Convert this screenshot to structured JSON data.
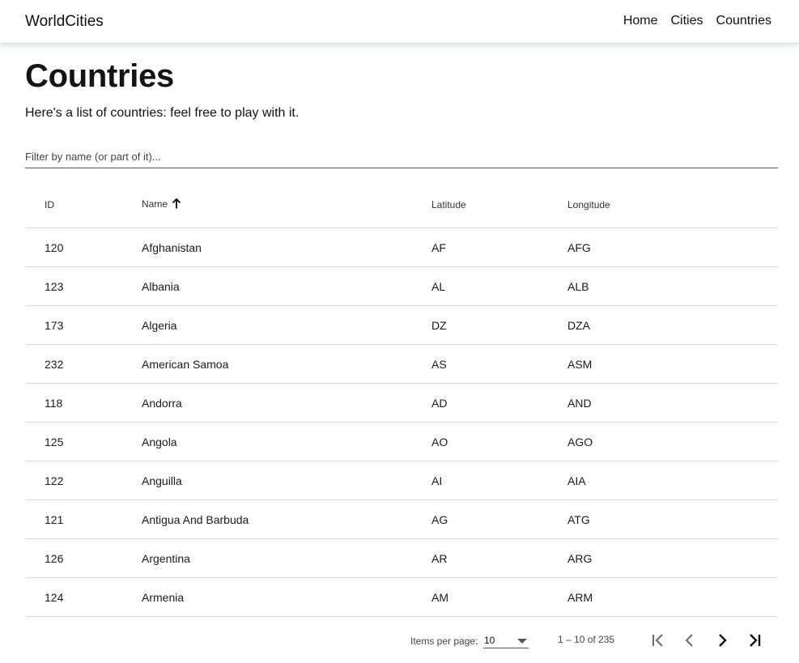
{
  "app": {
    "brand": "WorldCities"
  },
  "nav": {
    "items": [
      "Home",
      "Cities",
      "Countries"
    ]
  },
  "page": {
    "title": "Countries",
    "subtitle": "Here's a list of countries: feel free to play with it."
  },
  "filter": {
    "placeholder": "Filter by name (or part of it)...",
    "value": ""
  },
  "table": {
    "columns": [
      "ID",
      "Name",
      "Latitude",
      "Longitude"
    ],
    "sort": {
      "column": "Name",
      "direction": "asc",
      "icon": "arrow-up-icon"
    },
    "rows": [
      [
        "120",
        "Afghanistan",
        "AF",
        "AFG"
      ],
      [
        "123",
        "Albania",
        "AL",
        "ALB"
      ],
      [
        "173",
        "Algeria",
        "DZ",
        "DZA"
      ],
      [
        "232",
        "American Samoa",
        "AS",
        "ASM"
      ],
      [
        "118",
        "Andorra",
        "AD",
        "AND"
      ],
      [
        "125",
        "Angola",
        "AO",
        "AGO"
      ],
      [
        "122",
        "Anguilla",
        "AI",
        "AIA"
      ],
      [
        "121",
        "Antigua And Barbuda",
        "AG",
        "ATG"
      ],
      [
        "126",
        "Argentina",
        "AR",
        "ARG"
      ],
      [
        "124",
        "Armenia",
        "AM",
        "ARM"
      ]
    ]
  },
  "paginator": {
    "items_per_page_label": "Items per page:",
    "page_size": "10",
    "range_label": "1 – 10 of 235",
    "icons": [
      "first-page-icon",
      "previous-page-icon",
      "next-page-icon",
      "last-page-icon"
    ]
  },
  "colors": {
    "header_border": "#cfe0e0",
    "row_border": "#d8d8d8",
    "text": "#1f1f1f"
  }
}
